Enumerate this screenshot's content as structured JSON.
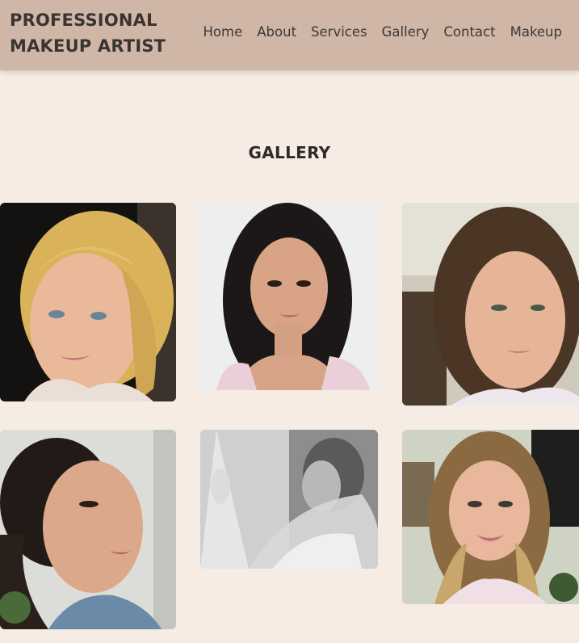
{
  "header": {
    "brand": "PROFESSIONAL\nMAKEUP ARTIST",
    "nav": [
      "Home",
      "About",
      "Services",
      "Gallery",
      "Contact",
      "Makeup"
    ]
  },
  "gallery": {
    "title": "GALLERY",
    "photos": [
      {
        "subject": "portrait-blonde-woman"
      },
      {
        "subject": "portrait-dark-wavy-hair-woman"
      },
      {
        "subject": "portrait-brunette-updo-woman"
      },
      {
        "subject": "portrait-profile-dark-hair-woman"
      },
      {
        "subject": "bride-black-and-white-veil"
      },
      {
        "subject": "portrait-smiling-blonde-highlights-woman"
      }
    ]
  },
  "colors": {
    "header_bg": "#d0b6a7",
    "page_bg": "#f6ece4",
    "text": "#2f2a27"
  }
}
